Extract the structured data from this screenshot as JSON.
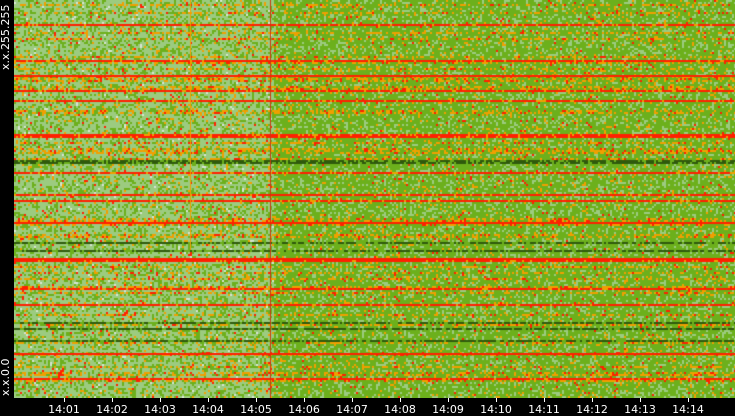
{
  "chart_data": {
    "type": "heatmap",
    "title": "",
    "xlabel": "",
    "ylabel": "",
    "x_tick_labels": [
      "14:01",
      "14:02",
      "14:03",
      "14:04",
      "14:05",
      "14:06",
      "14:07",
      "14:08",
      "14:09",
      "14:10",
      "14:11",
      "14:12",
      "14:13",
      "14:14"
    ],
    "y_tick_labels": {
      "top": "x.x.255.255",
      "bottom": "x.x.0.0"
    },
    "colors": {
      "low": "#9ccb80",
      "mid": "#6cb01c",
      "high": "#f0a000",
      "max": "#ff2000",
      "dark": "#2f5a0c",
      "sparse": "#d8e4d4"
    },
    "grid": false
  }
}
